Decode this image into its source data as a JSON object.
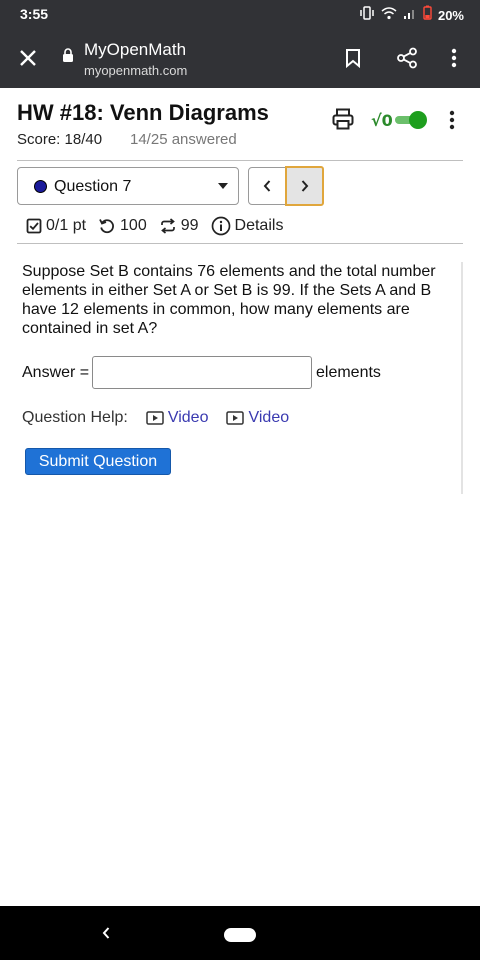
{
  "status_bar": {
    "time": "3:55",
    "battery_percent": "20%"
  },
  "browser": {
    "site_title": "MyOpenMath",
    "site_url": "myopenmath.com"
  },
  "header": {
    "title": "HW #18: Venn Diagrams",
    "score": "Score: 18/40",
    "answered": "14/25 answered",
    "sqrt_label": "√0"
  },
  "question_nav": {
    "selected": "Question 7",
    "prev_label": "‹",
    "next_label": "›"
  },
  "meta": {
    "points": "0/1 pt",
    "retries": "100",
    "attempts": "99",
    "details": "Details"
  },
  "question": {
    "text": "Suppose Set B contains 76 elements and the total number elements in either Set A or Set B is 99. If the Sets A and B have 12 elements in common, how many elements are contained in set A?",
    "answer_label": "Answer =",
    "answer_value": "",
    "answer_suffix": "elements",
    "help_label": "Question Help:",
    "video_links": [
      "Video",
      "Video"
    ],
    "submit_label": "Submit Question"
  },
  "colors": {
    "browser_bar": "#313236",
    "accent_green": "#1e9e1e",
    "submit_blue": "#1f72d6",
    "link_blue": "#3a3ab0",
    "next_button_border": "#e0a63c"
  }
}
